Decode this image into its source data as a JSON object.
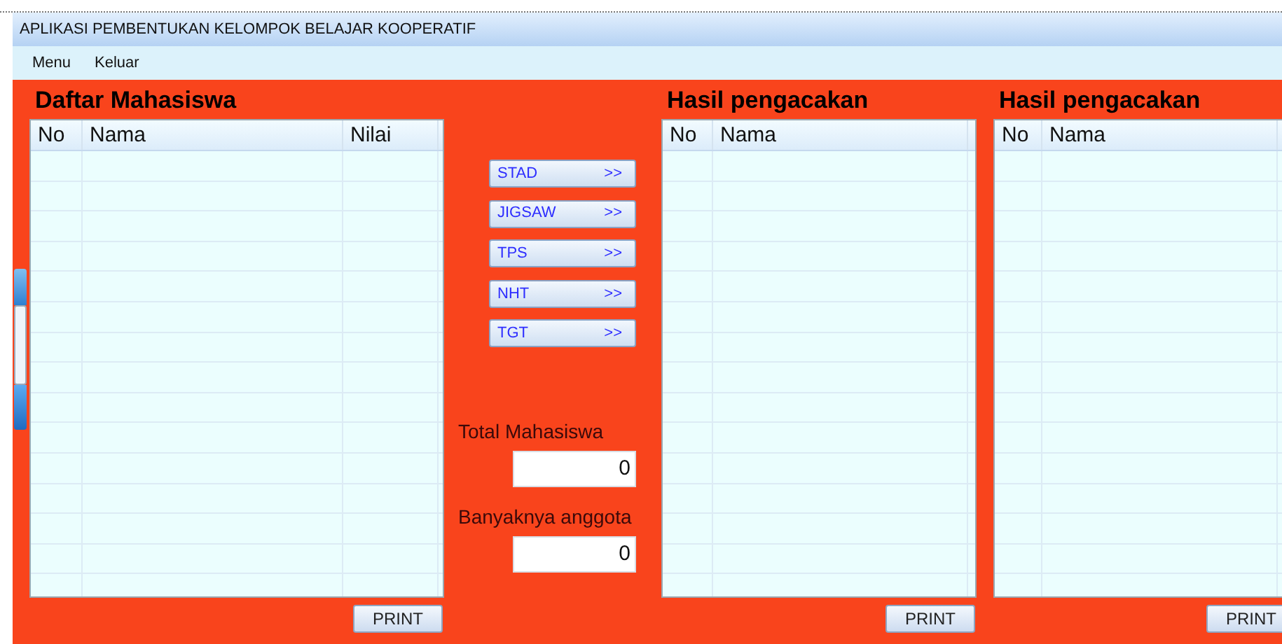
{
  "window": {
    "title": "APLIKASI PEMBENTUKAN KELOMPOK BELAJAR KOOPERATIF"
  },
  "menu": [
    "Menu",
    "Keluar"
  ],
  "student_table": {
    "title": "Daftar Mahasiswa",
    "columns": [
      "No",
      "Nama",
      "Nilai"
    ],
    "print_button": "PRINT"
  },
  "methods": [
    {
      "label": "STAD",
      "arrow": ">>"
    },
    {
      "label": "JIGSAW",
      "arrow": ">>"
    },
    {
      "label": "TPS",
      "arrow": ">>"
    },
    {
      "label": "NHT",
      "arrow": ">>"
    },
    {
      "label": "TGT",
      "arrow": ">>"
    }
  ],
  "total": {
    "label": "Total Mahasiswa",
    "value": "0"
  },
  "members": {
    "label": "Banyaknya anggota",
    "value": "0"
  },
  "result_tables": [
    {
      "title": "Hasil pengacakan",
      "columns": [
        "No",
        "Nama"
      ],
      "print_button": "PRINT"
    },
    {
      "title": "Hasil pengacakan",
      "columns": [
        "No",
        "Nama"
      ],
      "print_button": "PRINT"
    }
  ]
}
